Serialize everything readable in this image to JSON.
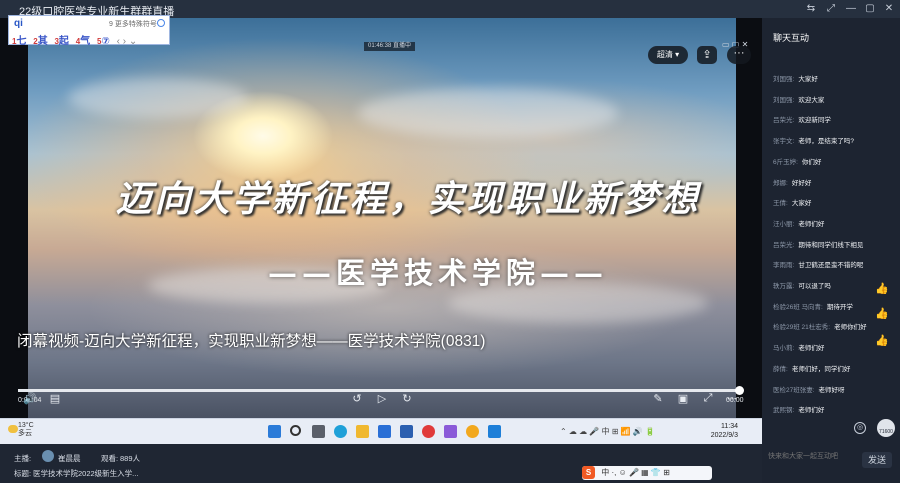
{
  "window": {
    "title": "22级口腔医学专业新生群群直播",
    "controls": [
      "⇆",
      "⤢",
      "—",
      "▢",
      "✕"
    ]
  },
  "ime_popup": {
    "input": "qi",
    "hint": "9 更多特殊符号",
    "candidates": [
      {
        "num": "1",
        "text": "七"
      },
      {
        "num": "2",
        "text": "其"
      },
      {
        "num": "3",
        "text": "起"
      },
      {
        "num": "4",
        "text": "气"
      },
      {
        "num": "5",
        "text": "⑦"
      }
    ],
    "nav": "‹ › ⌄"
  },
  "video": {
    "live_time": "01:46:38 直播中",
    "headline": "迈向大学新征程，实现职业新梦想",
    "college": "——医学技术学院——",
    "caption": "闭幕视频-迈向大学新征程，实现职业新梦想——医学技术学院(0831)",
    "quality_label": "超清",
    "current_time": "0:02:04",
    "total_time": "00:00",
    "progress": 1.0
  },
  "player_icons": {
    "volume": "🔊",
    "danmaku": "▤",
    "rewind": "↺",
    "play": "▷",
    "forward": "↻",
    "pen": "✎",
    "pip": "▣",
    "fullscreen": "⤢",
    "more": "⋯"
  },
  "taskbar": {
    "weather_temp": "13°C",
    "weather_desc": "多云",
    "clock_time": "11:34",
    "clock_date": "2022/9/3",
    "tray": "⌃ ☁ ☁ 🎤 中 ⊞ 📶 🔊 🔋"
  },
  "info": {
    "host_label": "主播:",
    "host_name": "崔晨晨",
    "viewers_label": "观看:",
    "viewers": "889人",
    "title_label": "标题:",
    "stream_title": "医学技术学院2022级新生入学...",
    "ime_bar": "中 ·, ☺ 🎤 ▦ 👕 ⊞"
  },
  "chat": {
    "title": "聊天互动",
    "messages": [
      {
        "name": "刘国强:",
        "text": "大家好"
      },
      {
        "name": "刘国强:",
        "text": "欢迎大家"
      },
      {
        "name": "吕荣光:",
        "text": "欢迎新同学"
      },
      {
        "name": "张宇文:",
        "text": "老师，是结束了吗?"
      },
      {
        "name": "6斤玉婷:",
        "text": "你们好"
      },
      {
        "name": "郑娜:",
        "text": "好好好"
      },
      {
        "name": "王倩:",
        "text": "大家好"
      },
      {
        "name": "汪小丽:",
        "text": "老师们好"
      },
      {
        "name": "吕荣光:",
        "text": "期待和同学们线下相见"
      },
      {
        "name": "李雨雨:",
        "text": "甘卫鹤还是蛮不错的呢"
      },
      {
        "name": "轶万露:",
        "text": "可以退了吗"
      },
      {
        "name": "检验26班 马向青:",
        "text": "期待开学"
      },
      {
        "name": "检验29班 21杜宏秀:",
        "text": "老师你们好"
      },
      {
        "name": "马小莉:",
        "text": "老师们好"
      },
      {
        "name": "薛倩:",
        "text": "老师们好，同学们好"
      },
      {
        "name": "医检27班张妻:",
        "text": "老师好呀"
      },
      {
        "name": "武熙钢:",
        "text": "老师们好"
      }
    ],
    "avatar_label": "71600",
    "input_placeholder": "快来和大家一起互动吧",
    "send_label": "发送"
  },
  "colors": {
    "chrome_bg": "#1f2633",
    "chat_bg": "#1d2431",
    "accent": "#2a58c6",
    "taskbar_bg": "#e8edf6"
  }
}
